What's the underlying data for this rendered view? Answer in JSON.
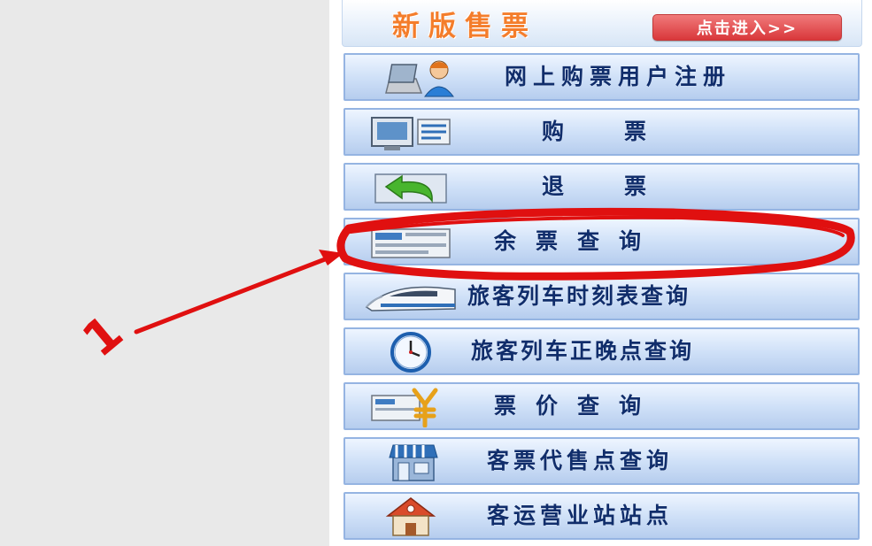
{
  "header": {
    "title": "新版售票",
    "enter_button": "点击进入>>"
  },
  "menu": {
    "items": [
      {
        "label": "网上购票用户注册",
        "icon": "user-laptop-icon"
      },
      {
        "label": "购　　票",
        "icon": "monitor-icon"
      },
      {
        "label": "退　　票",
        "icon": "return-arrow-icon"
      },
      {
        "label": "余票查询",
        "icon": "ticket-list-icon"
      },
      {
        "label": "旅客列车时刻表查询",
        "icon": "bullet-train-icon"
      },
      {
        "label": "旅客列车正晚点查询",
        "icon": "clock-icon"
      },
      {
        "label": "票价查询",
        "icon": "yen-price-icon"
      },
      {
        "label": "客票代售点查询",
        "icon": "shop-icon"
      },
      {
        "label": "客运营业站站点",
        "icon": "house-station-icon"
      }
    ]
  },
  "annotation": {
    "number": "1",
    "color": "#e01010"
  }
}
